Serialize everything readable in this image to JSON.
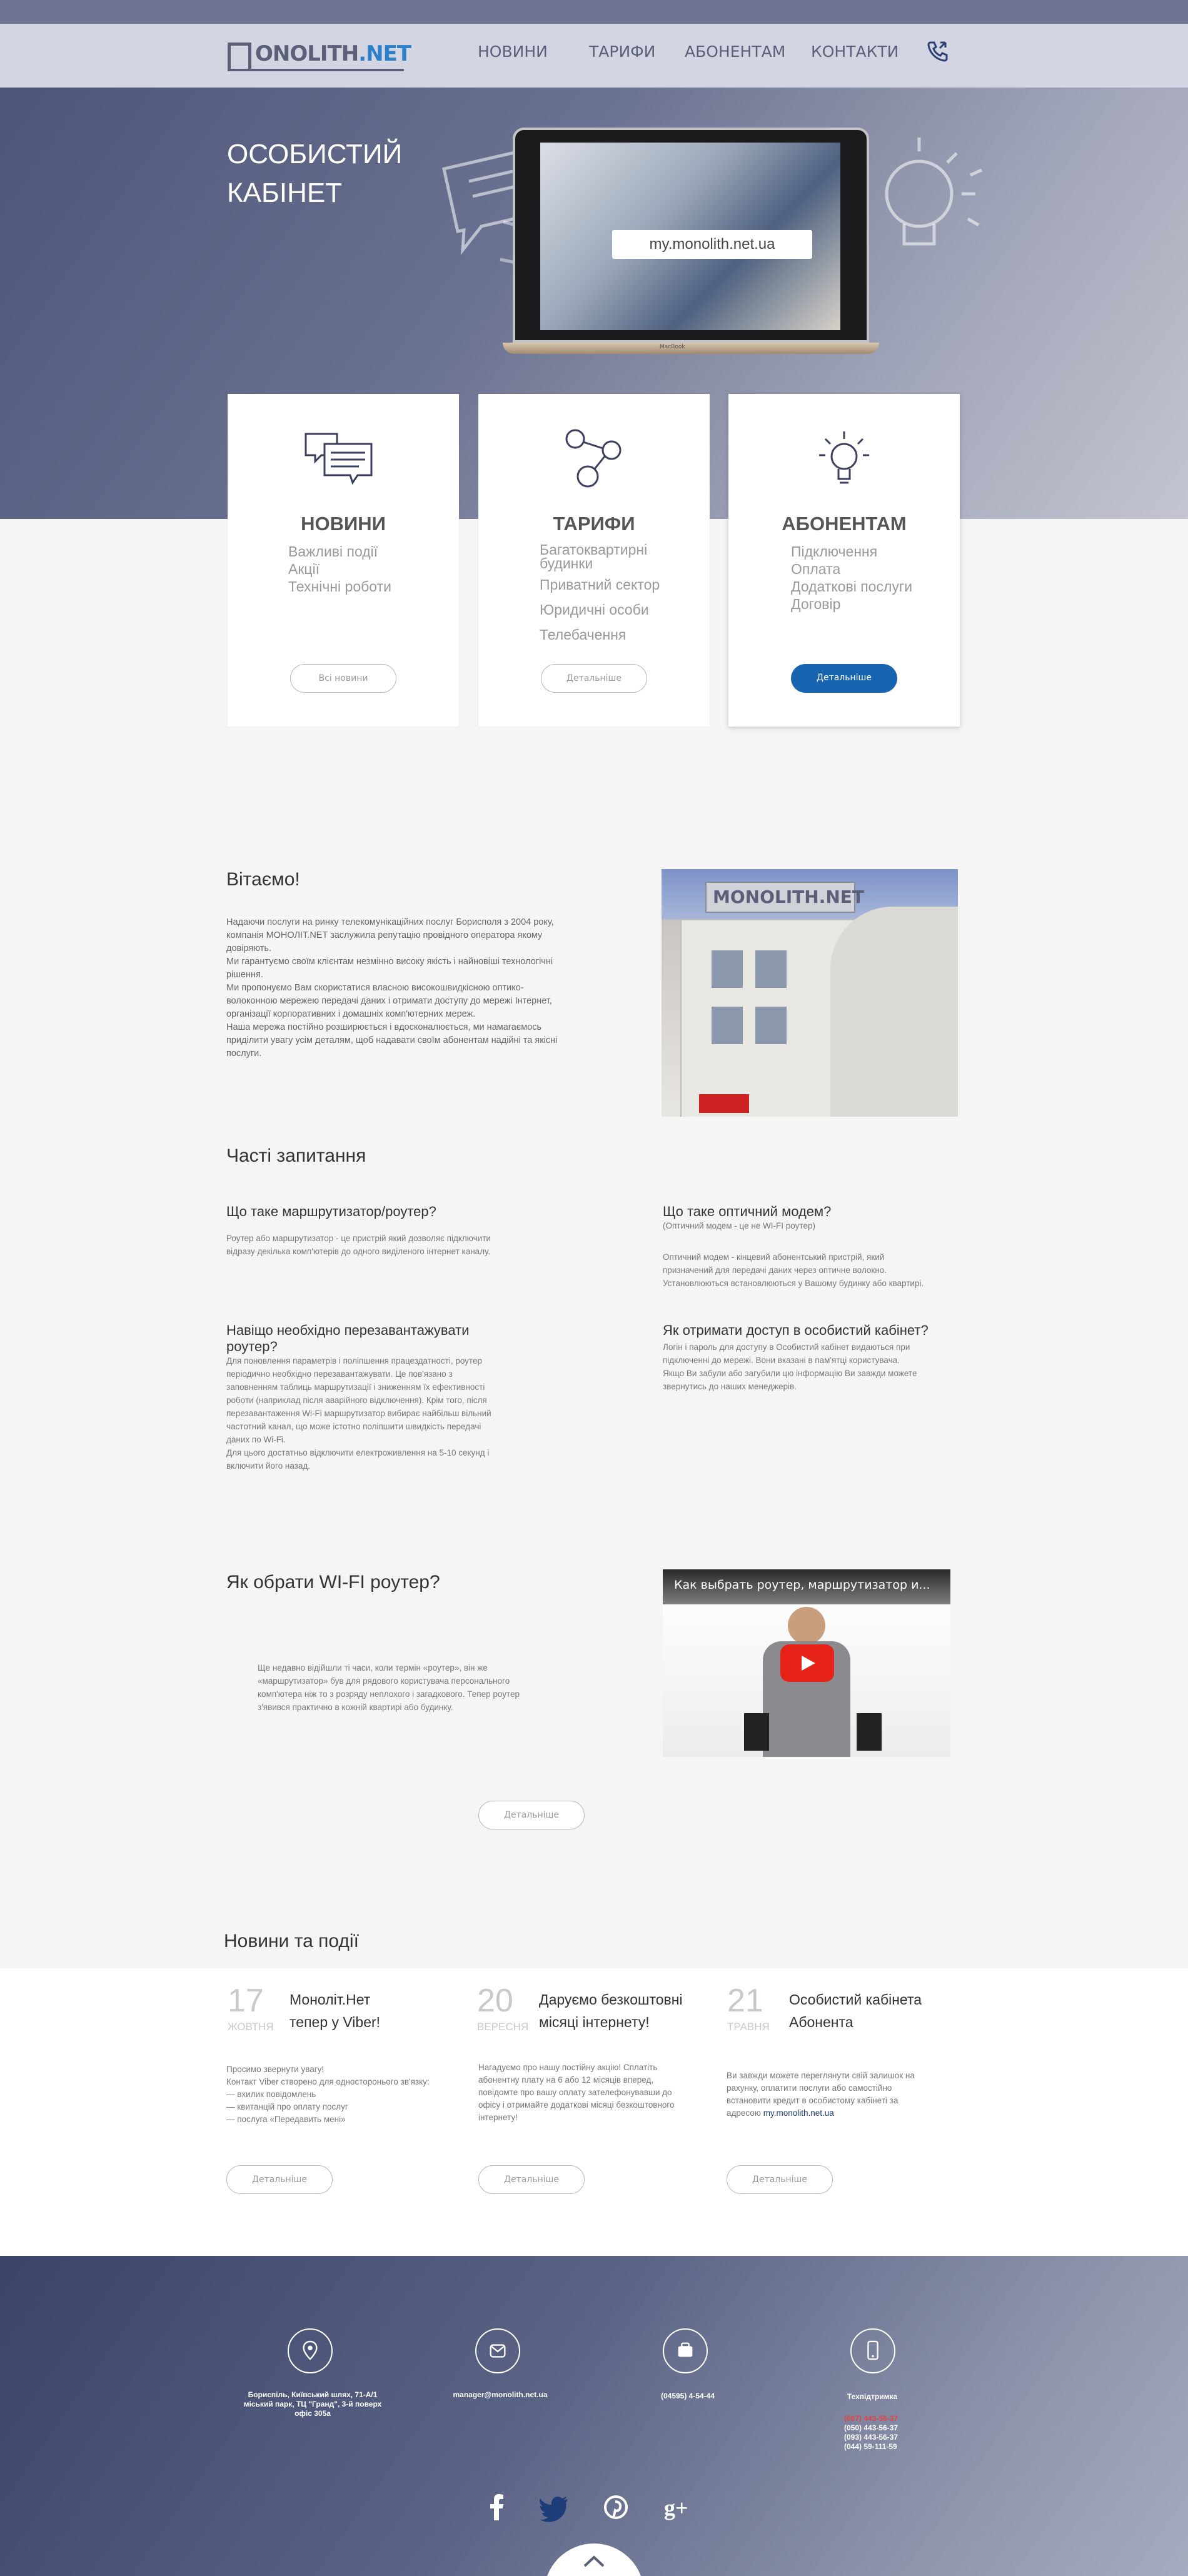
{
  "brand": {
    "logo_main": "ONOLITH",
    "logo_net": ".NET"
  },
  "nav": {
    "items": [
      "НОВИНИ",
      "ТАРИФИ",
      "АБОНЕНТАМ",
      "КОНТАКТИ"
    ]
  },
  "hero": {
    "title_line1": "ОСОБИСТИЙ",
    "title_line2": "КАБІНЕТ",
    "url": "my.monolith.net.ua",
    "laptop_brand": "MacBook"
  },
  "cards": [
    {
      "title": "НОВИНИ",
      "items": [
        "Важливі події",
        "Акції",
        "Технічні роботи"
      ],
      "button": "Всі новини"
    },
    {
      "title": "ТАРИФИ",
      "items": [
        "Багатоквартирні будинки",
        "Приватний сектор",
        "Юридичні особи",
        "Телебачення"
      ],
      "button": "Детальніше"
    },
    {
      "title": "АБОНЕНТАМ",
      "items": [
        "Підключення",
        "Оплата",
        "Додаткові послуги",
        "Договір"
      ],
      "button": "Детальніше"
    }
  ],
  "welcome": {
    "title": "Вітаємо!",
    "text": "Надаючи послуги на ринку телекомунікаційних послуг Борисполя з 2004 року, компанія МОНОЛІТ.NET заслужила репутацію провідного оператора якому довіряють.\nМи гарантуємо своїм клієнтам незмінно високу якість і найновіші технологічні рішення.\nМи пропонуємо Вам скористатися власною високошвидкісною оптико-волоконною мережею передачі даних і отримати доступу до мережі Інтернет, організації корпоративних і домашніх комп'ютерних мереж.\nНаша мережа постійно розширюється і вдосконалюється, ми намагаємось приділити увагу усім деталям, щоб  надавати своїм абонентам надійні та якісні послуги."
  },
  "faq": {
    "title": "Часті запитання",
    "items": [
      {
        "q": "Що таке маршрутизатор/роутер?",
        "a": "Роутер або маршрутизатор - це пристрій який дозволяє підключити\nвідразу декілька комп'ютерів до одного виділеного інтернет каналу."
      },
      {
        "q": "Що таке оптичний модем?",
        "sub": "(Оптичний модем - це не WI-FI роутер)",
        "a": "Оптичний модем - кінцевий абонентський пристрій, який\nпризначений для передачі даних через оптичне волокно.\nУстановлюються встановлюються у Вашому будинку або квартирі."
      },
      {
        "q": "Навіщо необхідно перезавантажувати роутер?",
        "a": "Для поновлення параметрів і поліпшення працездатності, роутер\nперіодично необхідно перезавантажувати. Це пов'язано з\nзаповненням таблиць маршрутизації і зниженням їх ефективності\nроботи (наприклад після аварійного відключення). Крім того, після\nперезавантаження Wi-Fi маршрутизатор вибирає найбільш вільний\nчастотний канал, що може істотно поліпшити швидкість передачі\nданих по Wi-Fi.\nДля цього достатньо відключити електроживлення на 5-10 секунд і\nвключити його назад."
      },
      {
        "q": "Як отримати доступ в особистий кабінет?",
        "a": "Логін і пароль для доступу в Особистий кабінет видаються при\nпідключенні до мережі. Вони вказані в пам'ятці користувача.\nЯкщо Ви забули або загубили цю інформацію Ви завжди можете\nзвернутись до наших менеджерів."
      }
    ]
  },
  "router": {
    "title": "Як обрати WI-FI роутер?",
    "text": "Ще недавно відійшли ті часи, коли термін «роутер», він же\n«маршрутизатор» був для рядового користувача персонального\nкомп'ютера ніж то з розряду неплохого і загадкового. Тепер роутер\nз'явився практично в кожній квартирі або будинку.",
    "video_title": "Как выбрать роутер, маршрутизатор и...",
    "button": "Детальніше"
  },
  "news": {
    "title": "Новини та події",
    "items": [
      {
        "day": "17",
        "month": "ЖОВТНЯ",
        "head": "Моноліт.Нет\nтепер у Viber!",
        "text": "Просимо звернути увагу!\nКонтакт Viber створено для односторонього зв'язку:\n— вхилик повідомлень\n— квитанцій про оплату послуг\n— послуга «Передавить мені»",
        "button": "Детальніше"
      },
      {
        "day": "20",
        "month": "ВЕРЕСНЯ",
        "head": "Даруємо безкоштовні\nмісяці інтернету!",
        "text": "Нагадуємо про нашу постійну акцію! Сплатіть\nабонентну плату на 6 або 12 місяців вперед,\nповідомте про вашу оплату зателефонувавши до\nофісу і отримайте додаткові місяці безкоштовного\nінтернету!",
        "button": "Детальніше"
      },
      {
        "day": "21",
        "month": "ТРАВНЯ",
        "head": "Особистий кабінета\nАбонента",
        "text": "Ви завжди можете переглянути свій залишок на\nрахунку, оплатити послуги або самостійно\nвстановити кредит в особистому кабінеті за\nадресою",
        "link": "my.monolith.net.ua",
        "button": "Детальніше"
      }
    ]
  },
  "footer": {
    "address": "Бориспіль, Київський шлях, 71-А/1\nміський парк, ТЦ \"Гранд\", 3-й поверх\nофіс 305а",
    "email": "manager@monolith.net.ua",
    "phone": "(04595) 4-54-44",
    "support_label": "Техпідтримка",
    "support_phones": [
      "(067) 443-56-37",
      "(050) 443-56-37",
      "(093) 443-56-37",
      "(044) 59-111-59"
    ]
  },
  "colors": {
    "accent": "#1765b0",
    "nav_text": "#5b6078",
    "logo_net": "#2c7fc9"
  },
  "icons": [
    "phone-icon",
    "chat-icon",
    "molecule-icon",
    "bulb-icon",
    "location-icon",
    "mail-icon",
    "wallet-icon",
    "mobile-icon",
    "facebook-icon",
    "twitter-icon",
    "pinterest-icon",
    "google-plus-icon",
    "chevron-up-icon"
  ]
}
